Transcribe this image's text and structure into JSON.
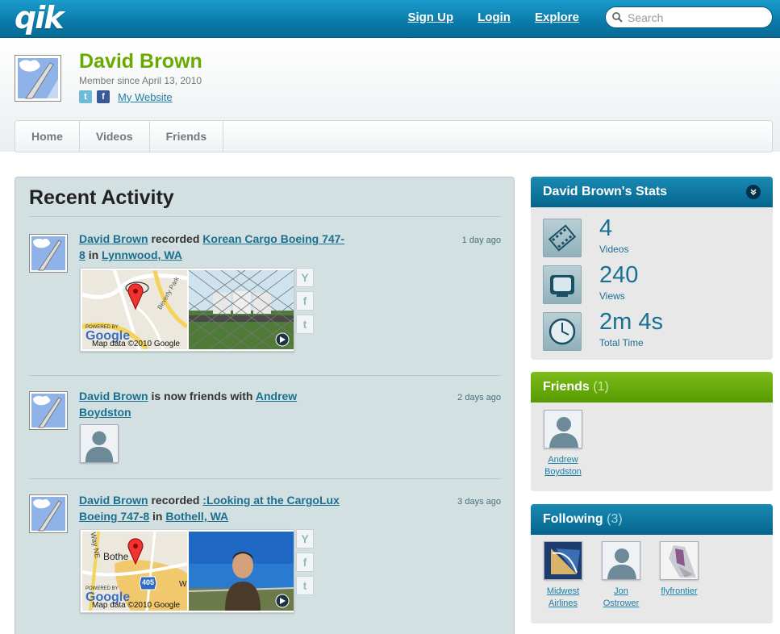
{
  "topbar": {
    "logo": "qik",
    "links": [
      "Sign Up",
      "Login",
      "Explore"
    ],
    "search_placeholder": "Search"
  },
  "profile": {
    "name": "David Brown",
    "member_since": "Member since April 13, 2010",
    "website_label": "My Website"
  },
  "tabs": [
    "Home",
    "Videos",
    "Friends"
  ],
  "activity": {
    "title": "Recent Activity",
    "items": [
      {
        "user": "David Brown",
        "verb": "recorded",
        "object": "Korean Cargo Boeing 747-8",
        "prep": "in",
        "place": "Lynnwood, WA",
        "time": "1 day ago",
        "map_credit": "Map data ©2010 Google",
        "powered_by": "POWERED BY",
        "google": "Google",
        "map_street": "Beverly Park"
      },
      {
        "user": "David Brown",
        "verb": "is now friends with",
        "object": "Andrew Boydston",
        "time": "2 days ago"
      },
      {
        "user": "David Brown",
        "verb": "recorded",
        "object": ":Looking at the CargoLux Boeing 747-8",
        "prep": "in",
        "place": "Bothell, WA",
        "time": "3 days ago",
        "map_credit": "Map data ©2010 Google",
        "powered_by": "POWERED BY",
        "google": "Google",
        "map_town": "Bothe",
        "map_road": "405",
        "map_w": "W",
        "map_way": "Way NE"
      }
    ]
  },
  "stats": {
    "title": "David Brown's Stats",
    "rows": [
      {
        "icon": "film-icon",
        "value": "4",
        "label": "Videos"
      },
      {
        "icon": "tv-icon",
        "value": "240",
        "label": "Views"
      },
      {
        "icon": "clock-icon",
        "value": "2m 4s",
        "label": "Total Time"
      }
    ]
  },
  "friends": {
    "title": "Friends",
    "count": "(1)",
    "people": [
      {
        "first": "Andrew",
        "last": "Boydston"
      }
    ]
  },
  "following": {
    "title": "Following",
    "count": "(3)",
    "people": [
      {
        "first": "Midwest",
        "last": "Airlines"
      },
      {
        "first": "Jon",
        "last": "Ostrower"
      },
      {
        "first": "flyfrontier",
        "last": ""
      }
    ]
  },
  "colors": {
    "brand_blue": "#0a7aa8",
    "name_green": "#6aaa00",
    "link_blue": "#1b6f8f"
  }
}
